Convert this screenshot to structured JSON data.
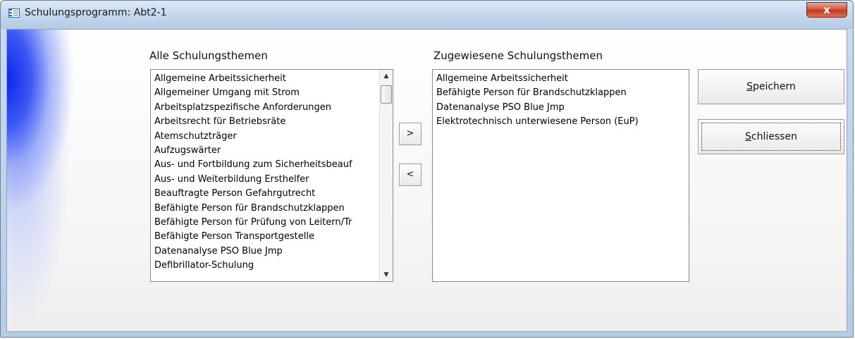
{
  "window": {
    "title": "Schulungsprogramm: Abt2-1",
    "icon": "form-icon",
    "close_label": "x"
  },
  "left_list": {
    "title": "Alle Schulungsthemen",
    "items": [
      "Allgemeine Arbeitssicherheit",
      "Allgemeiner Umgang mit Strom",
      "Arbeitsplatzspezifische Anforderungen",
      "Arbeitsrecht für Betriebsräte",
      "Atemschutzträger",
      "Aufzugswärter",
      "Aus- und Fortbildung zum Sicherheitsbeauf",
      "Aus- und Weiterbildung Ersthelfer",
      "Beauftragte Person Gefahrgutrecht",
      "Befähigte Person für Brandschutzklappen",
      "Befähigte Person für Prüfung von Leitern/Tr",
      "Befähigte Person Transportgestelle",
      "Datenanalyse PSO Blue Jmp",
      "Defibrillator-Schulung"
    ],
    "scroll_up": "▲",
    "scroll_down": "▼"
  },
  "right_list": {
    "title": "Zugewiesene Schulungsthemen",
    "items": [
      "Allgemeine Arbeitssicherheit",
      "Befähigte Person für Brandschutzklappen",
      "Datenanalyse PSO Blue Jmp",
      "Elektrotechnisch unterwiesene Person (EuP)"
    ]
  },
  "transfer": {
    "add_label": ">",
    "remove_label": "<"
  },
  "actions": {
    "save_mnemonic": "S",
    "save_rest": "peichern",
    "close_mnemonic": "S",
    "close_rest": "chliessen"
  }
}
